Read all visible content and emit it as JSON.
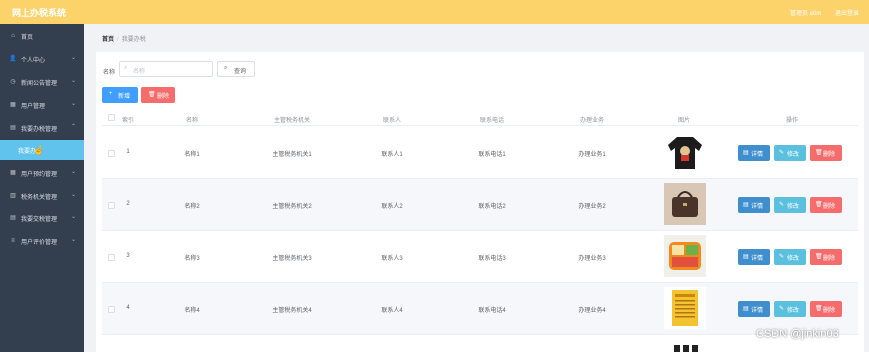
{
  "header": {
    "title": "网上办税系统",
    "user": "管理员 a0m",
    "logout": "退出登录"
  },
  "sidebar": {
    "items": [
      {
        "label": "首页",
        "icon": "home-icon"
      },
      {
        "label": "个人中心",
        "icon": "user-icon"
      },
      {
        "label": "新闻公告管理",
        "icon": "clock-icon"
      },
      {
        "label": "用户管理",
        "icon": "grid-icon"
      },
      {
        "label": "我要办税管理",
        "icon": "document-icon"
      },
      {
        "label": "我要办",
        "icon": ""
      },
      {
        "label": "用户预约管理",
        "icon": "grid-icon"
      },
      {
        "label": "税务机关管理",
        "icon": "building-icon"
      },
      {
        "label": "我要交税管理",
        "icon": "document-icon"
      },
      {
        "label": "用户评价管理",
        "icon": "list-icon"
      }
    ]
  },
  "breadcrumb": {
    "home": "首页",
    "sep": "/",
    "current": "我要办税"
  },
  "search": {
    "label": "名称",
    "placeholder": "名称",
    "button": "查询"
  },
  "actions": {
    "add": "新增",
    "delete": "删除"
  },
  "table": {
    "headers": [
      "索引",
      "名称",
      "主管税务机关",
      "联系人",
      "联系电话",
      "办理业务",
      "图片",
      "操作"
    ],
    "rows": [
      {
        "index": "1",
        "name": "名称1",
        "authority": "主管税务机关1",
        "contact": "联系人1",
        "phone": "联系电话1",
        "business": "办理业务1",
        "image": "black-sweater-image"
      },
      {
        "index": "2",
        "name": "名称2",
        "authority": "主管税务机关2",
        "contact": "联系人2",
        "phone": "联系电话2",
        "business": "办理业务2",
        "image": "brown-handbag-image"
      },
      {
        "index": "3",
        "name": "名称3",
        "authority": "主管税务机关3",
        "contact": "联系人3",
        "phone": "联系电话3",
        "business": "办理业务3",
        "image": "lunchbox-image"
      },
      {
        "index": "4",
        "name": "名称4",
        "authority": "主管税务机关4",
        "contact": "联系人4",
        "phone": "联系电话4",
        "business": "办理业务4",
        "image": "yellow-book-image"
      }
    ],
    "row_actions": {
      "detail": "详情",
      "edit": "修改",
      "delete": "删除"
    }
  },
  "watermark": "CSDN @jinkin03",
  "colors": {
    "header": "#fbd36a",
    "sidebar": "#333f4e",
    "sidebar_active": "#60c3ee",
    "primary": "#409eff",
    "danger": "#f56c6c",
    "info": "#5bc0de"
  }
}
